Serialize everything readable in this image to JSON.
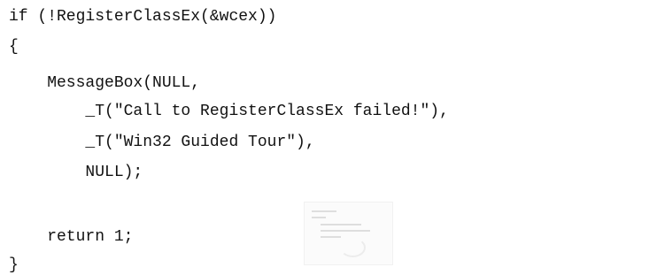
{
  "code": {
    "lines": [
      "if (!RegisterClassEx(&wcex))",
      "{",
      "    MessageBox(NULL,",
      "        _T(\"Call to RegisterClassEx failed!\"),",
      "        _T(\"Win32 Guided Tour\"),",
      "        NULL);",
      "",
      "    return 1;",
      "}"
    ]
  },
  "thumbnail": {
    "icon": "code-thumbnail-icon"
  }
}
